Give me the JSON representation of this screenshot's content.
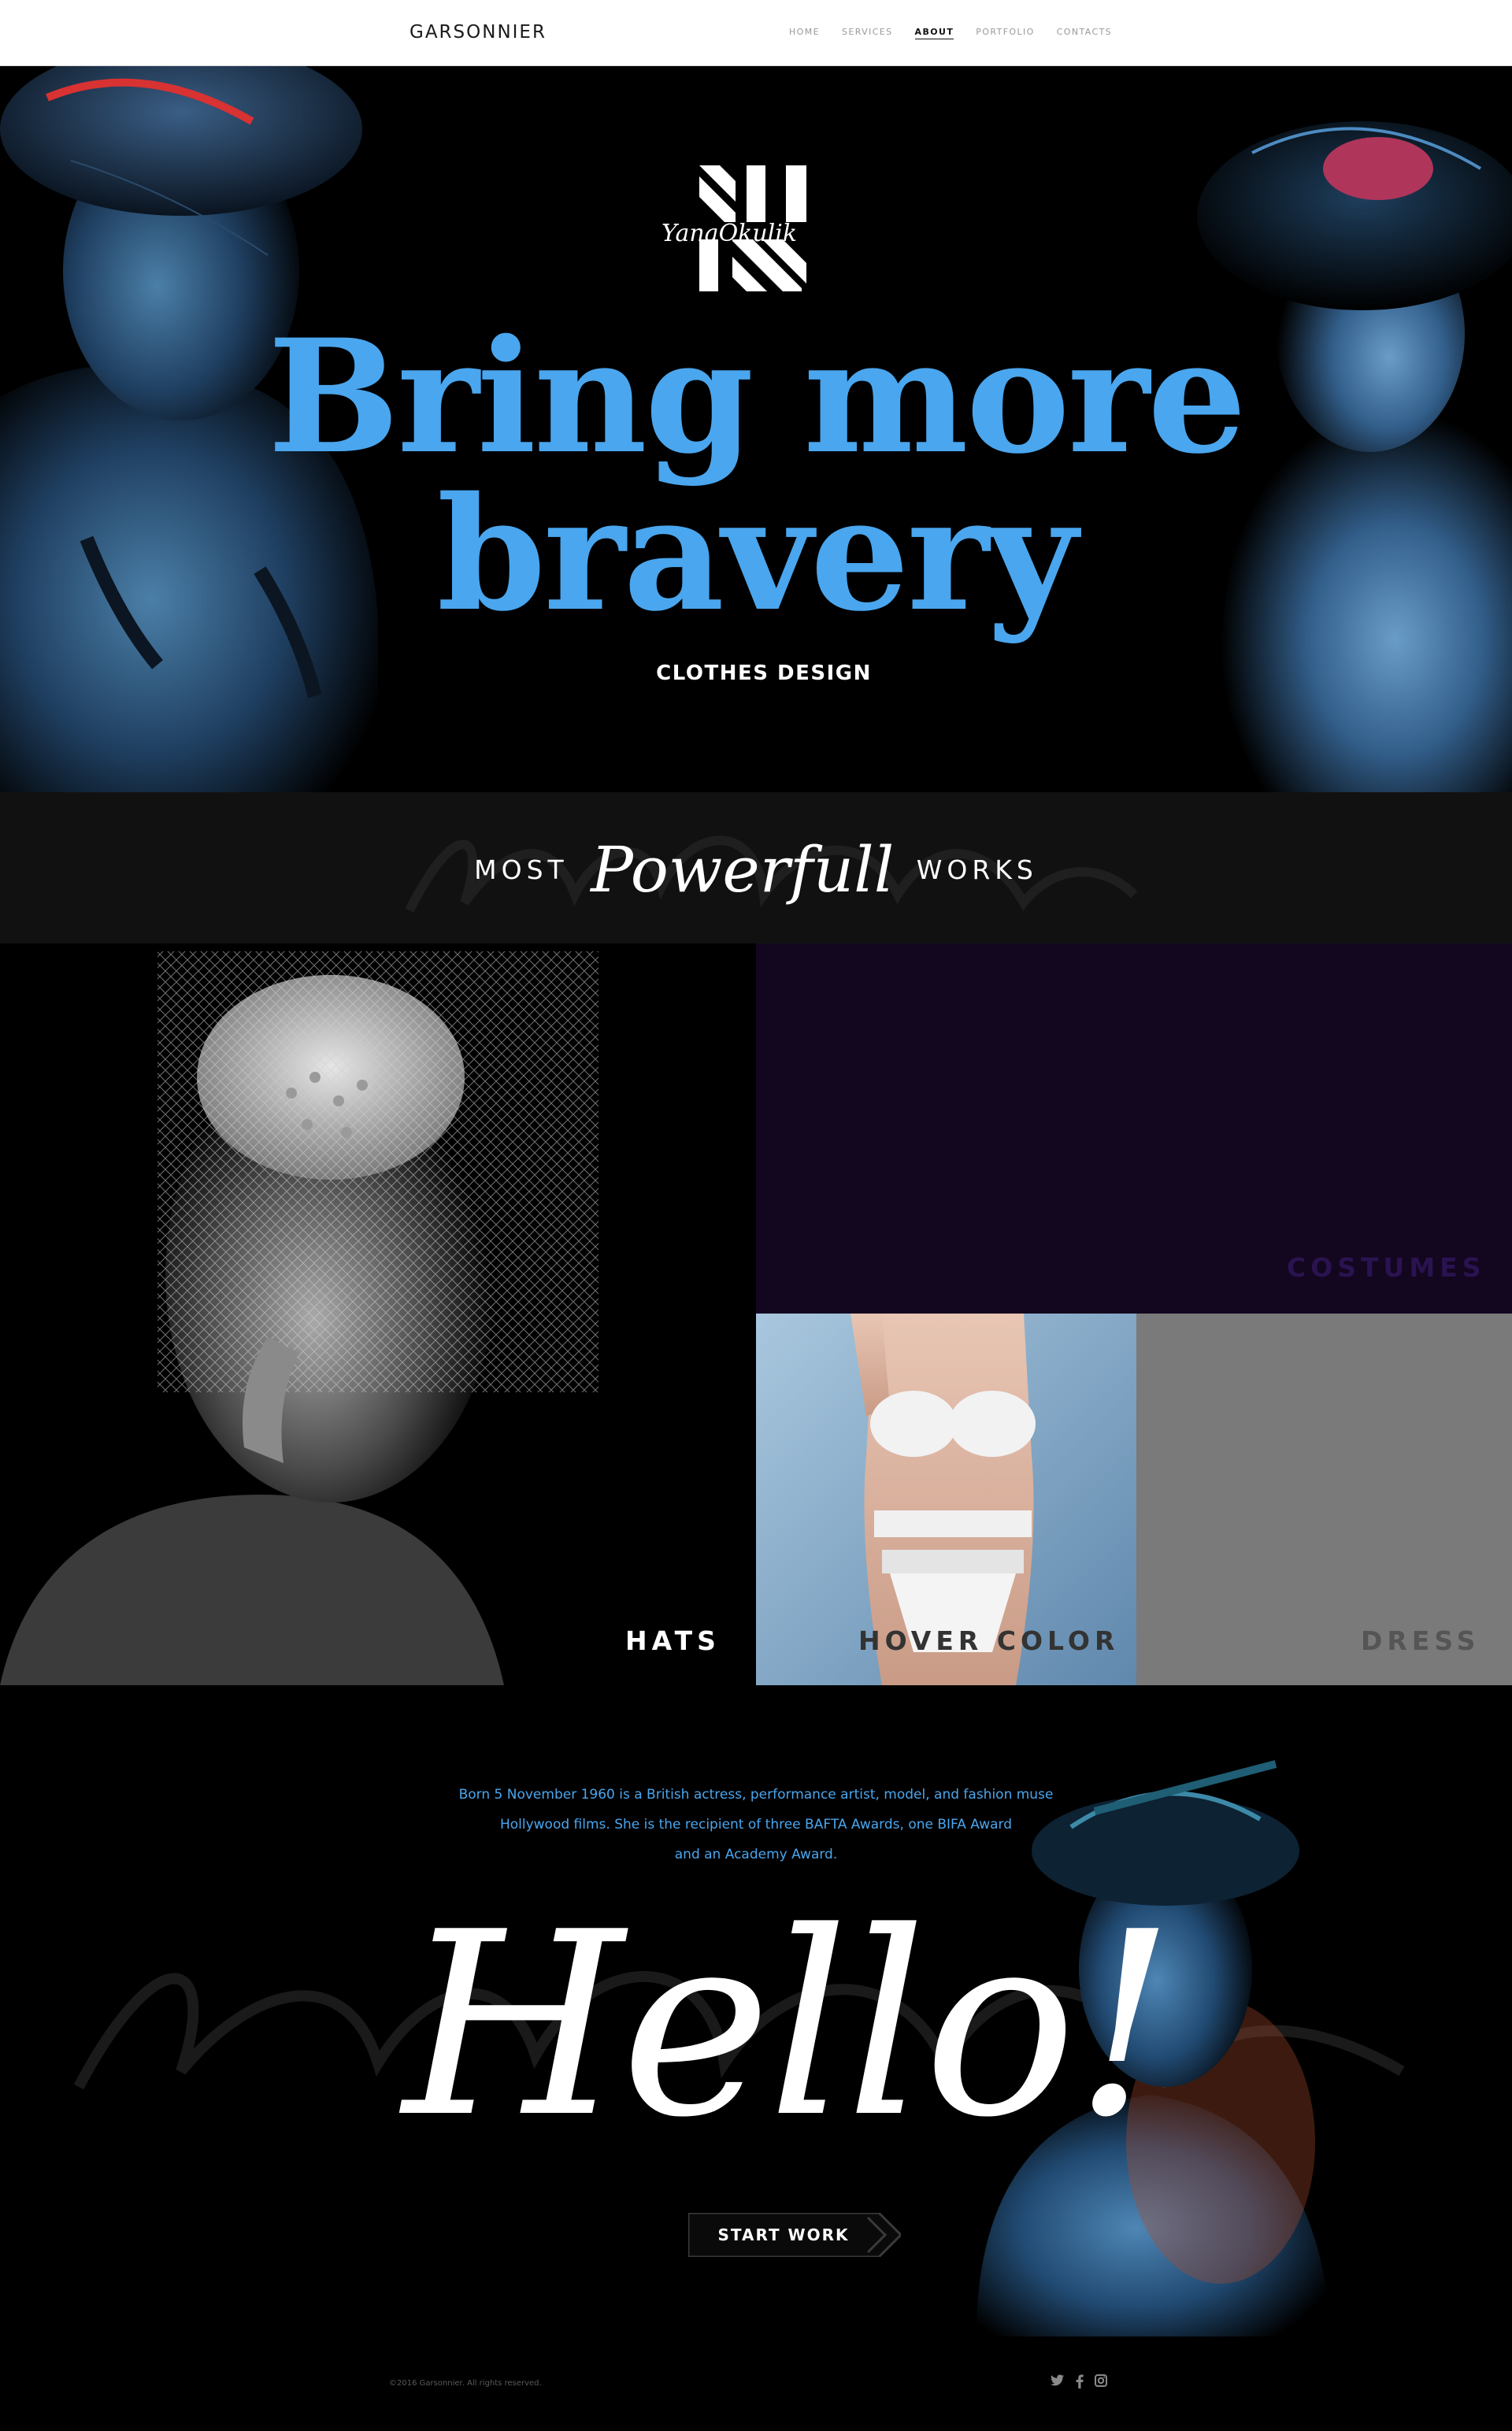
{
  "header": {
    "brand": "GARSONNIER",
    "nav": [
      "HOME",
      "SERVICES",
      "ABOUT",
      "PORTFOLIO",
      "CONTACTS"
    ],
    "active_nav": "ABOUT"
  },
  "hero": {
    "signature": "YanaOkulik",
    "title_line1": "Bring more",
    "title_line2": "bravery",
    "subtitle": "CLOTHES DESIGN"
  },
  "works": {
    "heading_left": "MOST",
    "heading_emphasis": "Powerfull",
    "heading_right": "WORKS",
    "tiles": {
      "hats": "HATS",
      "costumes": "COSTUMES",
      "hover": "HOVER COLOR",
      "dress": "DRESS"
    }
  },
  "about": {
    "bio_line1": "Born 5 November 1960 is a British actress, performance artist, model, and fashion muse",
    "bio_line2": "Hollywood films. She is the recipient of three BAFTA Awards, one BIFA Award",
    "bio_line3": "and an Academy Award.",
    "hello": "Hello!",
    "cta": "START WORK"
  },
  "footer": {
    "copyright": "©2016 Garsonnier. All rights reserved."
  },
  "colors": {
    "accent_blue": "#4aa6ee",
    "costumes_tile": "#13061f",
    "costumes_label": "#2a1350",
    "dress_tile": "#7a7a7a",
    "dress_label": "#555555"
  },
  "icons": [
    "twitter-icon",
    "facebook-icon",
    "instagram-icon"
  ]
}
